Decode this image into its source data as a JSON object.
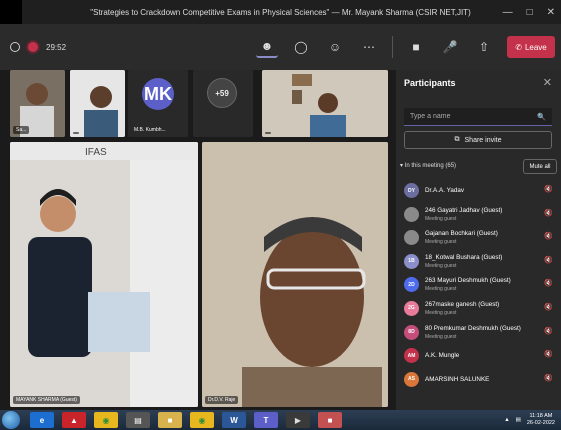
{
  "window": {
    "title": "\"Strategies to Crackdown Competitive Exams in Physical Sciences\" — Mr. Mayank Sharma (CSIR NET,JIT)",
    "controls": [
      "—",
      "□",
      "✕"
    ]
  },
  "meeting": {
    "timer": "29:52",
    "leave_label": "Leave",
    "toolbar_icons": [
      "participants-icon",
      "chat-icon",
      "reactions-icon",
      "more-icon",
      "camera-icon",
      "mic-off-icon",
      "share-icon",
      "phone-icon"
    ]
  },
  "stage": {
    "tiles": [
      {
        "label": "Sa..."
      },
      {
        "label": ""
      },
      {
        "label": "M.B. Kumbh..."
      },
      {
        "label": ""
      },
      {
        "label": ""
      },
      {
        "label": "MAYANK SHARMA (Guest)"
      },
      {
        "label": "Dr.D.V. Raje"
      }
    ],
    "mk_initials": "MK",
    "overflow_count": "+59",
    "banner_text": "IFAS"
  },
  "participants": {
    "header": "Participants",
    "search_placeholder": "Type a name",
    "share_invite": "Share invite",
    "in_meeting": "In this meeting (65)",
    "mute_all": "Mute all",
    "list": [
      {
        "initials": "DY",
        "name": "Dr.A.A. Yadav",
        "sub": "",
        "color": "#6b6e9e"
      },
      {
        "initials": "",
        "name": "246 Gayatri Jadhav (Guest)",
        "sub": "Meeting guest",
        "color": "#8a8a8a"
      },
      {
        "initials": "",
        "name": "Gajanan Bochkari (Guest)",
        "sub": "Meeting guest",
        "color": "#8a8a8a"
      },
      {
        "initials": "1B",
        "name": "18_Kotwal Bushara (Guest)",
        "sub": "Meeting guest",
        "color": "#8a8fc9"
      },
      {
        "initials": "2D",
        "name": "263 Mayuri Deshmukh (Guest)",
        "sub": "Meeting guest",
        "color": "#4f6bed"
      },
      {
        "initials": "2G",
        "name": "267maske ganesh (Guest)",
        "sub": "Meeting guest",
        "color": "#e87a9a"
      },
      {
        "initials": "8D",
        "name": "80 Premkumar Deshmukh (Guest)",
        "sub": "Meeting guest",
        "color": "#c44d7a"
      },
      {
        "initials": "AM",
        "name": "A.K. Mungle",
        "sub": "",
        "color": "#c4314b"
      },
      {
        "initials": "AS",
        "name": "AMARSINH SALUNKE",
        "sub": "",
        "color": "#d9773b"
      }
    ]
  },
  "taskbar": {
    "time": "11:18 AM",
    "date": "26-02-2022",
    "apps": [
      "browser",
      "pdf",
      "chrome",
      "notes",
      "folder",
      "chrome2",
      "word",
      "teams",
      "media",
      "paint"
    ]
  }
}
